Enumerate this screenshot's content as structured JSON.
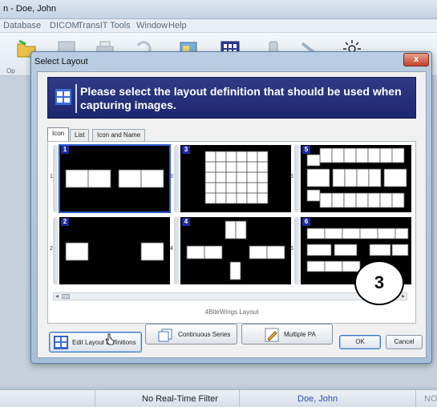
{
  "app": {
    "title": "n - Doe, John",
    "menu": [
      "Database",
      "DICOM",
      "TransIT",
      "Tools",
      "Window",
      "Help"
    ],
    "toolbar_first_label": "Op"
  },
  "status": {
    "filter": "No Real-Time Filter",
    "patient": "Doe, John",
    "right": "NO"
  },
  "dialog": {
    "title": "Select Layout",
    "close_glyph": "x",
    "banner_text": "Please select the layout definition that should be used when capturing images.",
    "tabs": [
      "Icon",
      "List",
      "Icon and Name"
    ],
    "active_tab": "Icon",
    "layouts": [
      {
        "number": "1",
        "row_label": "1"
      },
      {
        "number": "3",
        "row_label": "3"
      },
      {
        "number": "5",
        "row_label": "5"
      },
      {
        "number": "2",
        "row_label": "2"
      },
      {
        "number": "4",
        "row_label": "4"
      },
      {
        "number": "6",
        "row_label": "6"
      }
    ],
    "selected_layout": "1",
    "layout_caption": "4BiteWings Layout",
    "buttons": {
      "edit_layouts": "Edit Layout Definitions",
      "continuous": "Continuous Series",
      "multiple_pa": "Multiple PA",
      "ok": "OK",
      "cancel": "Cancel"
    }
  },
  "callout": "3",
  "colors": {
    "banner": "#1d2770",
    "thumb_bg": "#000000",
    "selection": "#2f5fd3",
    "badge": "#1d2aa0"
  }
}
